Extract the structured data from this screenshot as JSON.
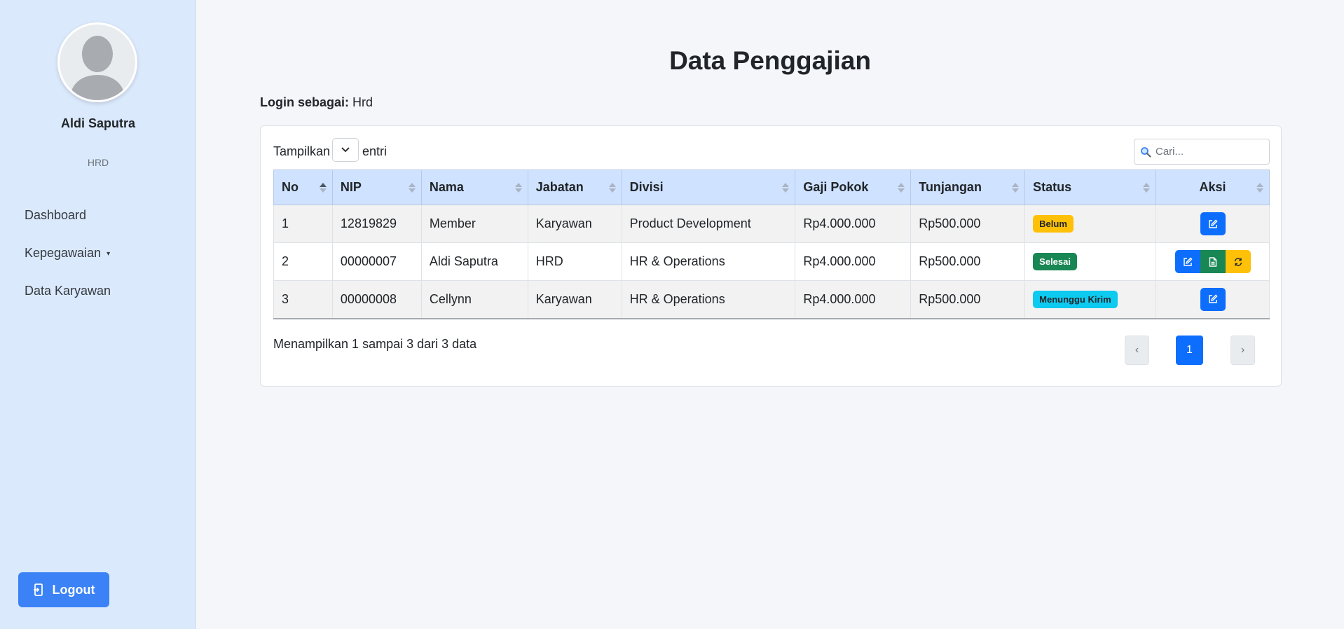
{
  "sidebar": {
    "user_name": "Aldi Saputra",
    "user_role": "HRD",
    "nav": [
      {
        "label": "Dashboard"
      },
      {
        "label": "Kepegawaian",
        "caret": "▾"
      },
      {
        "label": "Data Karyawan"
      }
    ],
    "logout_label": "Logout"
  },
  "main": {
    "title": "Data Penggajian",
    "login_prefix": "Login sebagai:",
    "login_value": "Hrd"
  },
  "table_controls": {
    "length_prefix": "Tampilkan",
    "length_suffix": "entri",
    "search_placeholder": "Cari..."
  },
  "table": {
    "columns": [
      "No",
      "NIP",
      "Nama",
      "Jabatan",
      "Divisi",
      "Gaji Pokok",
      "Tunjangan",
      "Status",
      "Aksi"
    ],
    "rows": [
      {
        "no": "1",
        "nip": "12819829",
        "nama": "Member",
        "jabatan": "Karyawan",
        "divisi": "Product Development",
        "gaji_pokok": "Rp4.000.000",
        "tunjangan": "Rp500.000",
        "status": "Belum",
        "status_color": "#ffc107"
      },
      {
        "no": "2",
        "nip": "00000007",
        "nama": "Aldi Saputra",
        "jabatan": "HRD",
        "divisi": "HR & Operations",
        "gaji_pokok": "Rp4.000.000",
        "tunjangan": "Rp500.000",
        "status": "Selesai",
        "status_color": "#198754"
      },
      {
        "no": "3",
        "nip": "00000008",
        "nama": "Cellynn",
        "jabatan": "Karyawan",
        "divisi": "HR & Operations",
        "gaji_pokok": "Rp4.000.000",
        "tunjangan": "Rp500.000",
        "status": "Menunggu Kirim",
        "status_color": "#0dcaf0"
      }
    ]
  },
  "footer": {
    "info": "Menampilkan 1 sampai 3 dari 3 data",
    "prev": "‹",
    "current_page": "1",
    "next": "›"
  },
  "colors": {
    "sidebar_bg": "#dbe9fc",
    "accent": "#0d6efd",
    "logout_bg": "#3b82f6",
    "header_bg": "#cfe2ff"
  },
  "icons": {
    "search": "search-icon",
    "edit": "edit-icon",
    "document": "document-icon",
    "refresh": "refresh-icon",
    "logout": "logout-icon",
    "dropdown": "chevron-down-icon"
  }
}
